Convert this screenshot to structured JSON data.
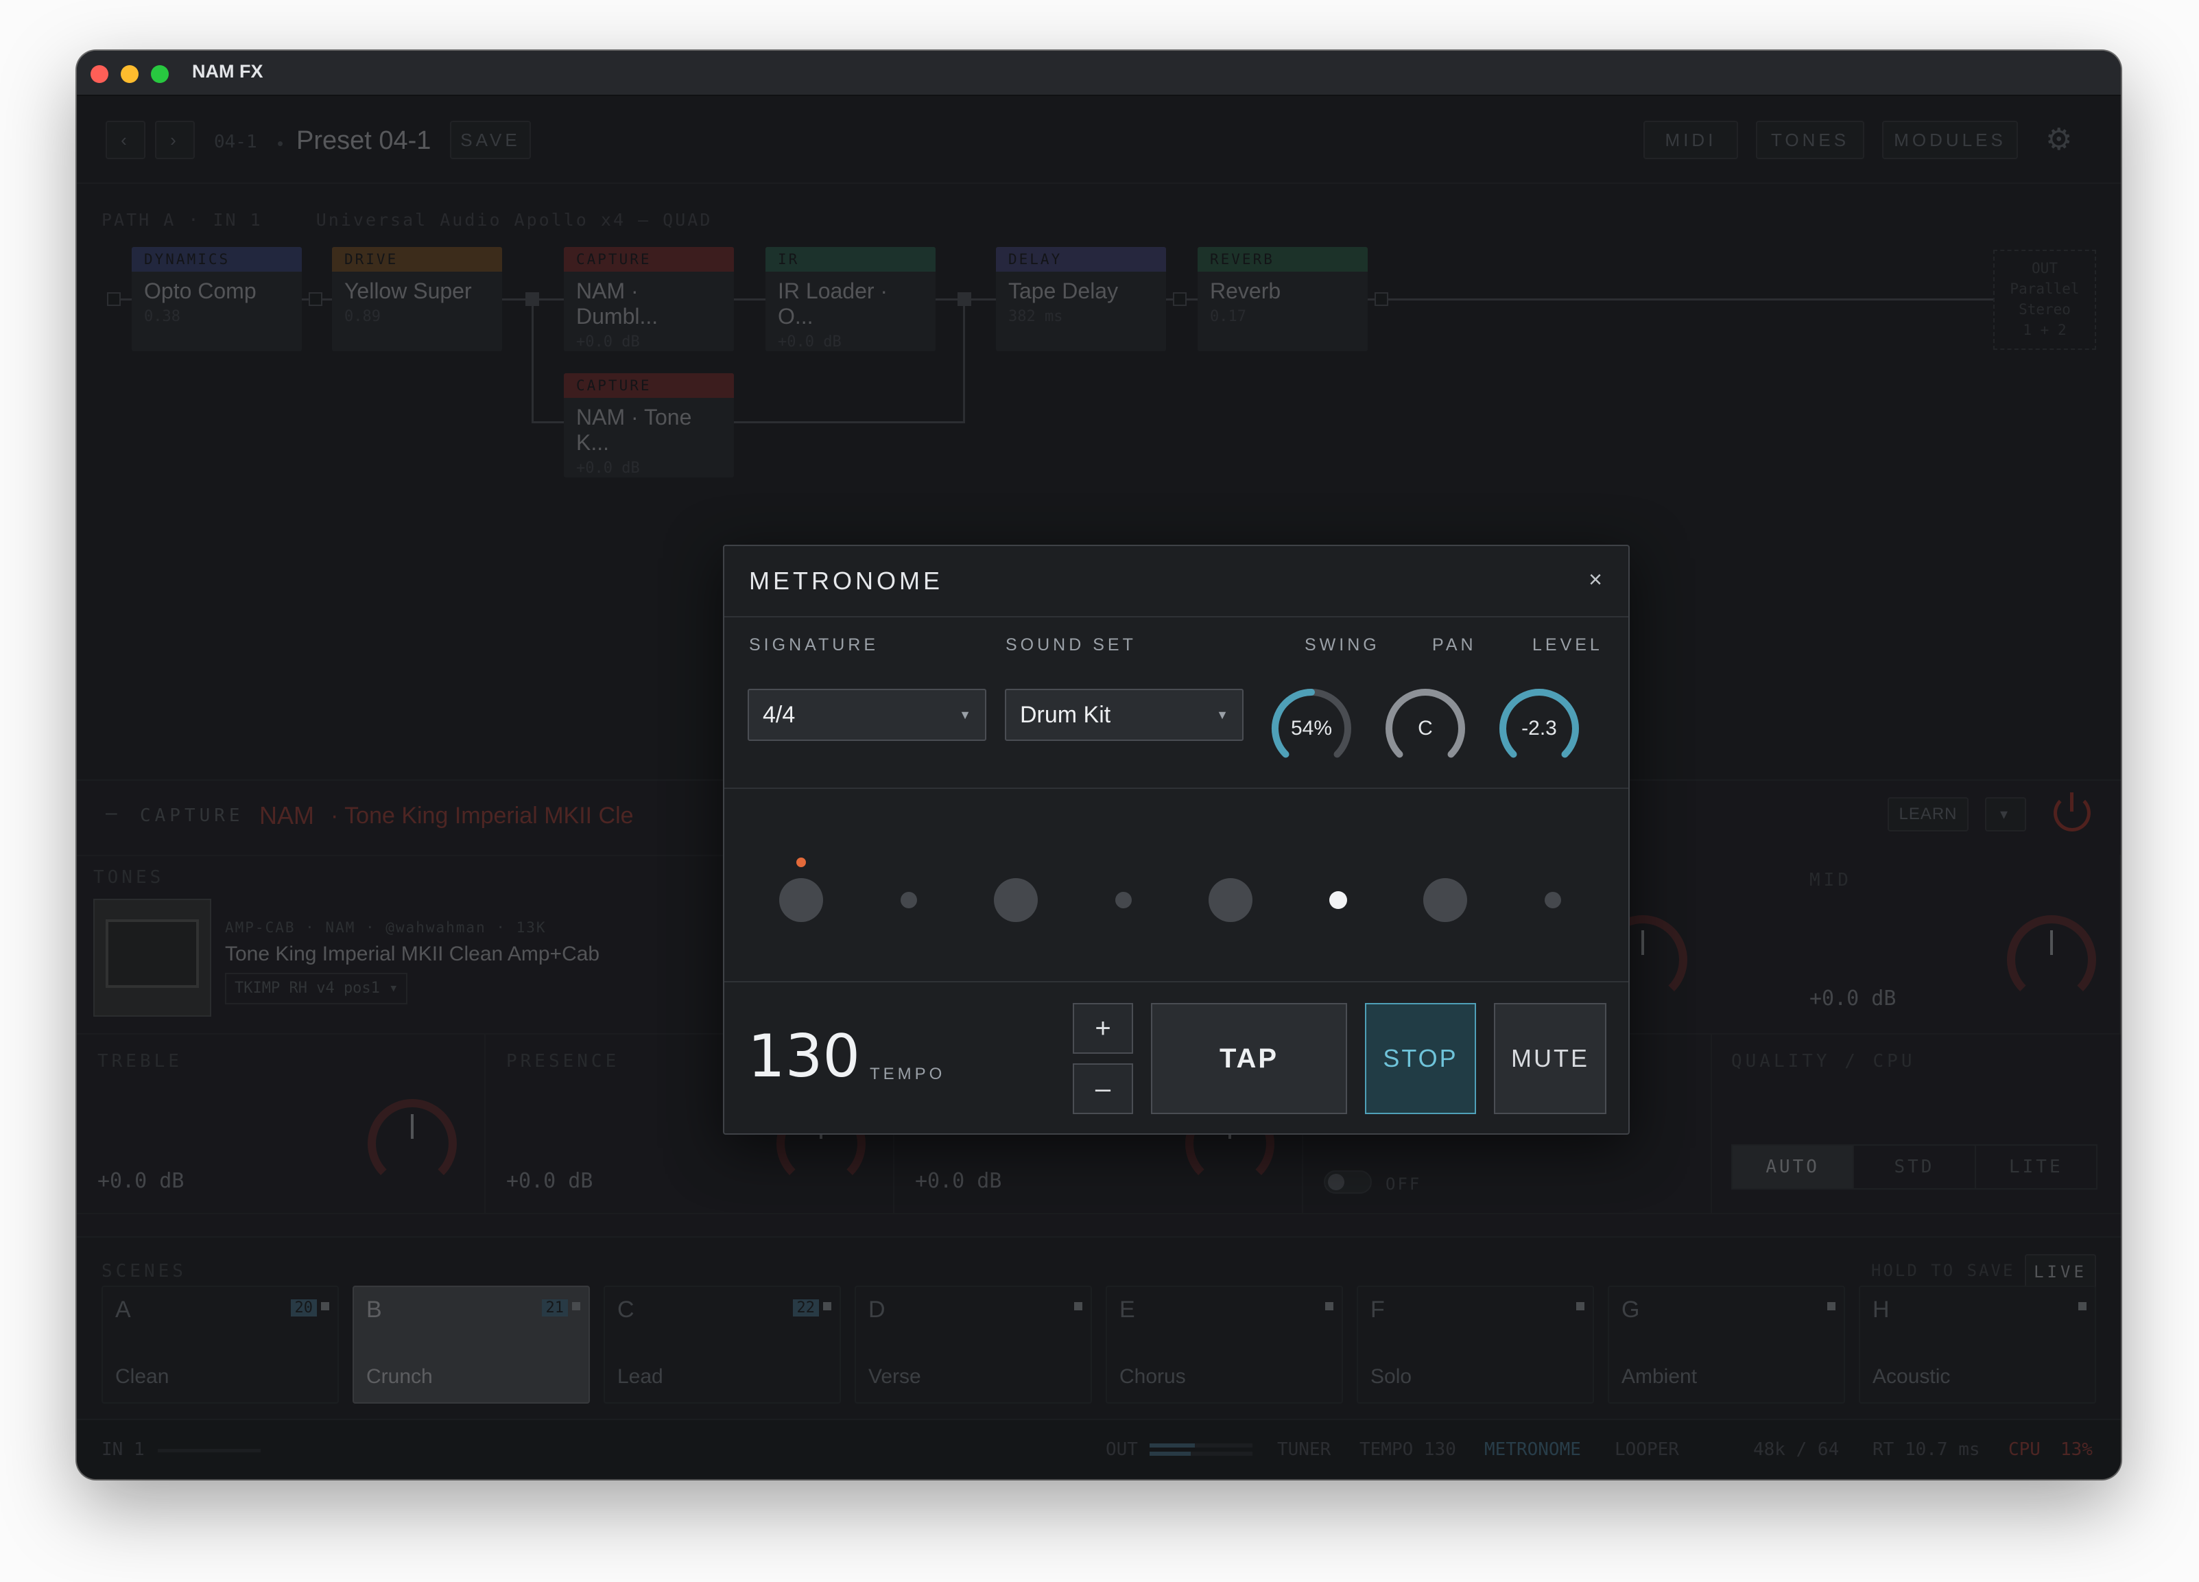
{
  "window": {
    "title": "NAM FX"
  },
  "topbar": {
    "prev": "‹",
    "next": "›",
    "preset_code": "04-1",
    "preset_name": "Preset 04-1",
    "save": "SAVE",
    "midi": "MIDI",
    "tones": "TONES",
    "modules": "MODULES"
  },
  "path": {
    "label": "PATH A · IN 1",
    "interface": "Universal Audio Apollo x4 — QUAD"
  },
  "blocks": [
    {
      "cat": "DYNAMICS",
      "name": "Opto Comp",
      "val": "0.38",
      "color": "#3d4a8a"
    },
    {
      "cat": "DRIVE",
      "name": "Yellow Super",
      "val": "0.89",
      "color": "#8a5a22"
    },
    {
      "cat": "CAPTURE",
      "name": "NAM · Dumbl...",
      "val": "+0.0 dB",
      "color": "#8a2e2e"
    },
    {
      "cat": "IR",
      "name": "IR Loader · O...",
      "val": "+0.0 dB",
      "color": "#2d6a54"
    },
    {
      "cat": "DELAY",
      "name": "Tape Delay",
      "val": "382 ms",
      "color": "#4a4a8a"
    },
    {
      "cat": "REVERB",
      "name": "Reverb",
      "val": "0.17",
      "color": "#2d6a4a"
    },
    {
      "cat": "CAPTURE",
      "name": "NAM · Tone K...",
      "val": "+0.0 dB",
      "color": "#8a2e2e"
    }
  ],
  "out": {
    "l1": "OUT",
    "l2": "Parallel",
    "l3": "Stereo",
    "l4": "1 + 2"
  },
  "detail": {
    "collapse": "–",
    "section": "CAPTURE",
    "model": "NAM",
    "model_name": "· Tone King Imperial MKII Cle",
    "learn": "LEARN",
    "dropdown": "▾",
    "tones_label": "TONES",
    "tone_meta": "AMP-CAB · NAM · @wahwahman · 13K",
    "tone_name": "Tone King Imperial MKII Clean Amp+Cab",
    "tone_file": "TKIMP RH v4 pos1 ▾",
    "mid_label": "MID",
    "mid_val": "+0.0 dB",
    "treble_label": "TREBLE",
    "treble_val": "+0.0 dB",
    "presence_label": "PRESENCE",
    "presence_val": "+0.0 dB",
    "third_val": "+0.0 dB",
    "toggle_label": "OFF",
    "quality_label": "QUALITY / CPU",
    "quality": [
      "AUTO",
      "STD",
      "LITE"
    ]
  },
  "scenes": {
    "label": "SCENES",
    "hold": "HOLD TO SAVE",
    "live": "LIVE",
    "items": [
      {
        "letter": "A",
        "name": "Clean",
        "midi": "20"
      },
      {
        "letter": "B",
        "name": "Crunch",
        "midi": "21"
      },
      {
        "letter": "C",
        "name": "Lead",
        "midi": "22"
      },
      {
        "letter": "D",
        "name": "Verse",
        "midi": ""
      },
      {
        "letter": "E",
        "name": "Chorus",
        "midi": ""
      },
      {
        "letter": "F",
        "name": "Solo",
        "midi": ""
      },
      {
        "letter": "G",
        "name": "Ambient",
        "midi": ""
      },
      {
        "letter": "H",
        "name": "Acoustic",
        "midi": ""
      }
    ]
  },
  "status": {
    "in": "IN 1",
    "out": "OUT",
    "tuner": "TUNER",
    "tempo": "TEMPO 130",
    "metronome": "METRONOME",
    "looper": "LOOPER",
    "rate": "48k / 64",
    "rt": "RT 10.7 ms",
    "cpu": "CPU",
    "cpu_val": "13%"
  },
  "metronome": {
    "title": "METRONOME",
    "close": "×",
    "signature_label": "SIGNATURE",
    "signature": "4/4",
    "soundset_label": "SOUND SET",
    "soundset": "Drum Kit",
    "swing_label": "SWING",
    "swing": "54%",
    "swing_level": 0.54,
    "pan_label": "PAN",
    "pan": "C",
    "level_label": "LEVEL",
    "level": "-2.3",
    "beats": 8,
    "active_beat": 6,
    "tempo": "130",
    "tempo_label": "TEMPO",
    "plus": "+",
    "minus": "–",
    "tap": "TAP",
    "stop": "STOP",
    "mute": "MUTE"
  }
}
